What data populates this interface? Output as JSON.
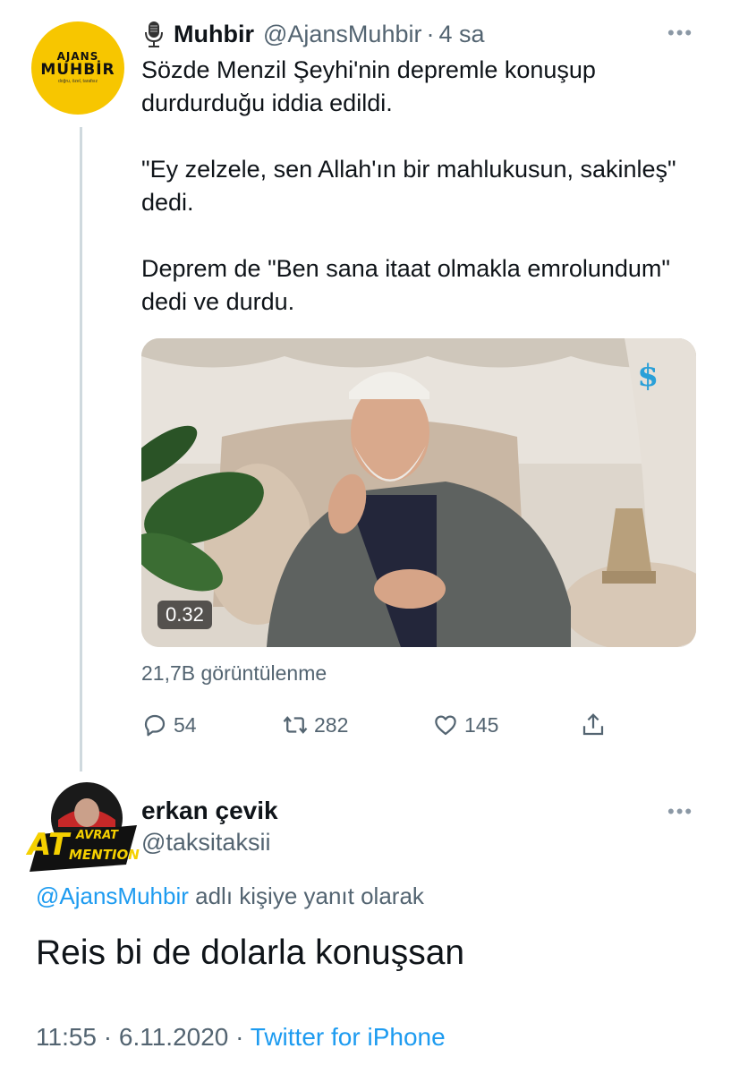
{
  "tweet": {
    "avatar": {
      "top": "AJANS",
      "main": "MUHBİR",
      "sub": "doğru, özel, tarafsız"
    },
    "author_name": "Muhbir",
    "author_handle": "@AjansMuhbir",
    "separator": "·",
    "time": "4 sa",
    "more_icon": "more-dots-icon",
    "text": [
      "Sözde Menzil Şeyhi'nin depremle konuşup durdurduğu iddia edildi.",
      "\"Ey zelzele, sen Allah'ın bir mahlukusun, sakinleş\" dedi.",
      "Deprem de \"Ben sana itaat olmakla emrolundum\" dedi ve durdu."
    ],
    "video_duration": "0.32",
    "video_brand": "$",
    "views": "21,7B görüntülenme",
    "actions": {
      "reply": {
        "icon": "reply-icon",
        "count": "54"
      },
      "retweet": {
        "icon": "retweet-icon",
        "count": "282"
      },
      "like": {
        "icon": "heart-icon",
        "count": "145"
      },
      "share": {
        "icon": "share-icon"
      }
    }
  },
  "reply": {
    "avatar": {
      "top": "AVRAT",
      "left": "AT",
      "bottom": "MENTION"
    },
    "author_name": "erkan çevik",
    "author_handle": "@taksitaksii",
    "replying_mention": "@AjansMuhbir",
    "replying_suffix": " adlı kişiye yanıt olarak",
    "text": "Reis bi de dolarla konuşsan",
    "time": "11:55",
    "date": "6.11.2020",
    "separator": "·",
    "source": "Twitter for iPhone"
  },
  "colors": {
    "link": "#1d9bf0",
    "secondary_text": "#536471",
    "avatar_yellow": "#f7c600"
  }
}
